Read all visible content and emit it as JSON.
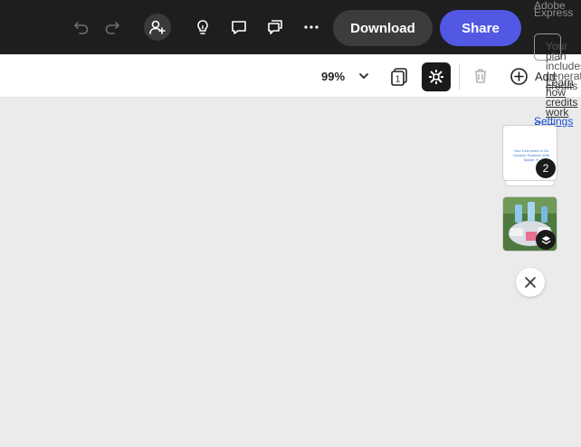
{
  "header": {
    "download_label": "Download",
    "share_label": "Share",
    "brand": "Adobe Express"
  },
  "toolbar": {
    "zoom": "99%",
    "pages_count": "1",
    "add_label": "Add"
  },
  "account_panel": {
    "credits_text": "Your plan includes generative credits",
    "learn_link": "Learn how credits work",
    "sign_out": "Sign Out",
    "settings": "Settings"
  },
  "pages_panel": {
    "page1_title": "Your Kids Need to Go Outside! Summer With Splash ☀",
    "page1_badge": "2"
  },
  "colors": {
    "header_bg": "#1e1e1e",
    "share_accent": "#5258e4",
    "canvas_bg": "#ebebeb"
  }
}
